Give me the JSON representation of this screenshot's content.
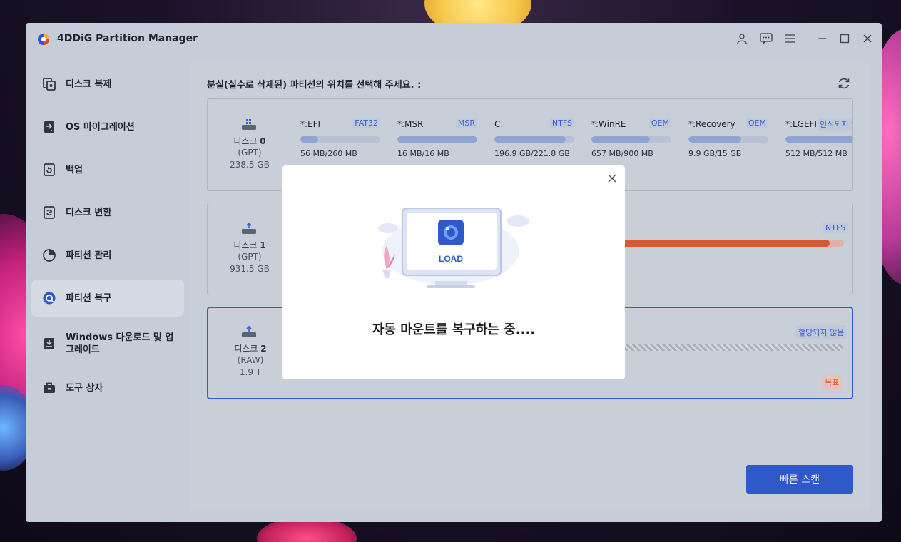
{
  "window": {
    "title": "4DDiG Partition Manager"
  },
  "titlebar_icons": [
    "account-icon",
    "feedback-icon",
    "menu-icon",
    "minimize-icon",
    "maximize-icon",
    "close-icon"
  ],
  "sidebar": {
    "items": [
      {
        "label": "디스크 복제",
        "icon": "disk-clone-icon"
      },
      {
        "label": "OS 마이그레이션",
        "icon": "os-migration-icon"
      },
      {
        "label": "백업",
        "icon": "backup-icon"
      },
      {
        "label": "디스크 변환",
        "icon": "disk-convert-icon"
      },
      {
        "label": "파티션 관리",
        "icon": "partition-manage-icon"
      },
      {
        "label": "파티션 복구",
        "icon": "partition-recovery-icon",
        "active": true
      },
      {
        "label": "Windows 다운로드 및 업그레이드",
        "icon": "windows-download-icon"
      },
      {
        "label": "도구 상자",
        "icon": "toolbox-icon"
      }
    ]
  },
  "main": {
    "title": "분실(실수로 삭제된) 파티션의 위치를 선택해 주세요. :",
    "disks": [
      {
        "name": "디스크",
        "number": "0",
        "type": "(GPT)",
        "size": "238.5 GB",
        "partitions": [
          {
            "name": "*:EFI",
            "fs": "FAT32",
            "size": "56 MB/260 MB",
            "used": 0.22
          },
          {
            "name": "*:MSR",
            "fs": "MSR",
            "size": "16 MB/16 MB",
            "used": 1.0
          },
          {
            "name": "C:",
            "fs": "NTFS",
            "size": "196.9 GB/221.8 GB",
            "used": 0.89
          },
          {
            "name": "*:WinRE",
            "fs": "OEM",
            "size": "657 MB/900 MB",
            "used": 0.73
          },
          {
            "name": "*:Recovery",
            "fs": "OEM",
            "size": "9.9 GB/15 GB",
            "used": 0.66
          },
          {
            "name": "*:LGEFI",
            "fs": "인식되지 않",
            "size": "512 MB/512 MB",
            "used": 1.0
          }
        ]
      },
      {
        "name": "디스크",
        "number": "1",
        "type": "(GPT)",
        "size": "931.5 GB",
        "fs_tag": "NTFS"
      },
      {
        "name": "디스크",
        "number": "2",
        "type": "(RAW)",
        "size": "1.9 T",
        "status_tag": "할당되지 않음",
        "target_tag": "목표"
      }
    ],
    "scan_button": "빠른 스캔"
  },
  "modal": {
    "screen_label": "LOAD",
    "message": "자동 마운트를 복구하는 중...."
  },
  "colors": {
    "accent": "#2f58c8",
    "selected_border": "#3a5bd0",
    "disk1_fill": "#d9582e",
    "target_tag": "#d9582e"
  }
}
